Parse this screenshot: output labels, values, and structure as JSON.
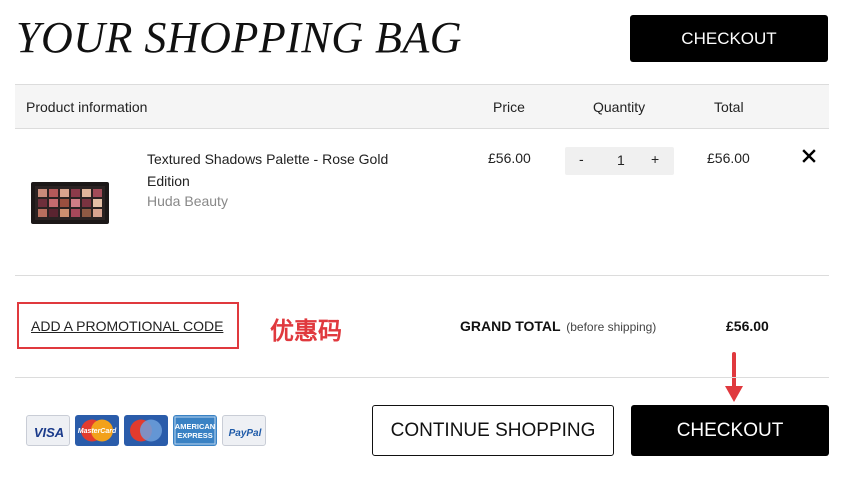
{
  "header": {
    "title": "YOUR SHOPPING BAG",
    "checkout_label": "CHECKOUT"
  },
  "table": {
    "columns": [
      "Product information",
      "Price",
      "Quantity",
      "Total"
    ]
  },
  "items": [
    {
      "name": "Textured Shadows Palette - Rose Gold Edition",
      "brand": "Huda Beauty",
      "price": "£56.00",
      "quantity": "1",
      "qty_minus": "-",
      "qty_plus": "+",
      "total": "£56.00",
      "remove_icon": "close-icon"
    }
  ],
  "summary": {
    "promo_label": "ADD A PROMOTIONAL CODE",
    "annotation": "优惠码",
    "grand_total_label": "GRAND TOTAL",
    "grand_total_note": "(before shipping)",
    "grand_total_value": "£56.00"
  },
  "footer": {
    "continue_label": "CONTINUE SHOPPING",
    "checkout_label": "CHECKOUT",
    "payment_methods": [
      "VISA",
      "MasterCard",
      "Maestro",
      "AMERICAN EXPRESS",
      "PayPal"
    ]
  },
  "colors": {
    "accent_red": "#e0393e",
    "button_black": "#000000",
    "header_bg": "#f5f5f5"
  }
}
